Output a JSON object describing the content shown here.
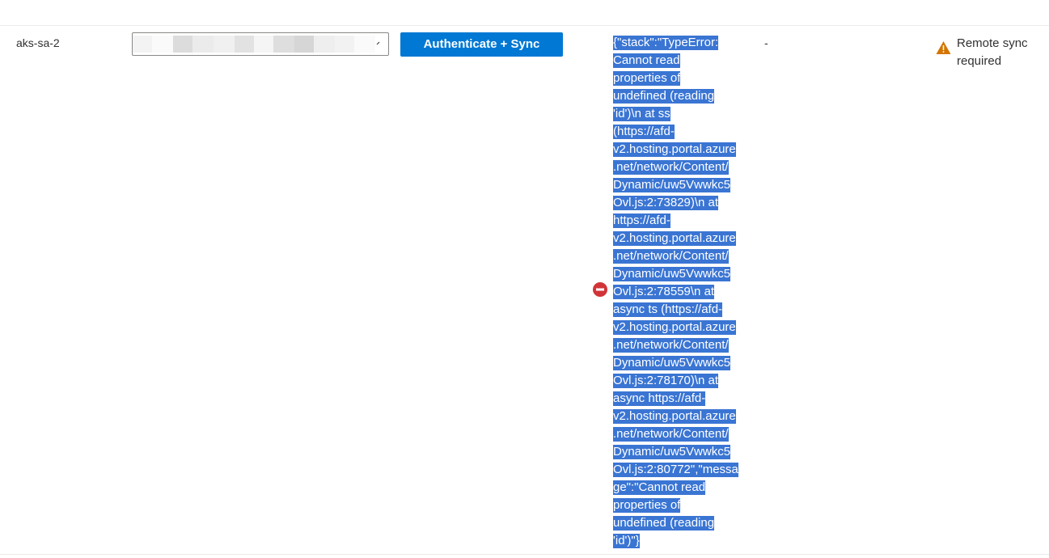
{
  "row": {
    "name": "aks-sa-2",
    "dropdown_value": "",
    "auth_button_label": "Authenticate + Sync",
    "error_lines": [
      "{\"stack\":\"TypeError:",
      "Cannot read",
      "properties of",
      "undefined (reading",
      "'id')\\n at ss",
      "(https://afd-",
      "v2.hosting.portal.azure",
      ".net/network/Content/",
      "Dynamic/uw5Vwwkc5",
      "Ovl.js:2:73829)\\n at",
      "https://afd-",
      "v2.hosting.portal.azure",
      ".net/network/Content/",
      "Dynamic/uw5Vwwkc5",
      "Ovl.js:2:78559\\n at",
      "async ts (https://afd-",
      "v2.hosting.portal.azure",
      ".net/network/Content/",
      "Dynamic/uw5Vwwkc5",
      "Ovl.js:2:78170)\\n at",
      "async https://afd-",
      "v2.hosting.portal.azure",
      ".net/network/Content/",
      "Dynamic/uw5Vwwkc5",
      "Ovl.js:2:80772\",\"messa",
      "ge\":\"Cannot read",
      "properties of",
      "undefined (reading",
      "'id')\"}"
    ],
    "dash": "-",
    "status_lines": [
      "Remote sync",
      "required"
    ]
  },
  "icons": {
    "error": "error-circle-icon",
    "warning": "warning-triangle-icon",
    "dropdown": "chevron-down-icon"
  },
  "colors": {
    "accent": "#0078d4",
    "error": "#d13438",
    "warning": "#d47500",
    "selection": "#3a75d3"
  }
}
